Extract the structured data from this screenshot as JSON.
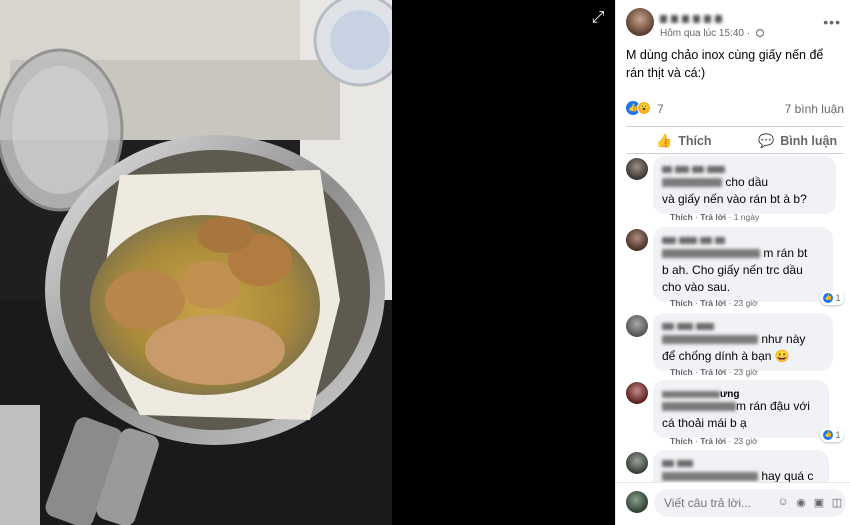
{
  "post": {
    "time": "Hôm qua lúc 15:40 · ",
    "caption": "M dùng chảo inox cùng giấy nến để rán thịt và cá:)",
    "reaction_count": "7",
    "comment_count": "7 bình luận"
  },
  "actions": {
    "like": "Thích",
    "comment": "Bình luận"
  },
  "comments": [
    {
      "text_a": " cho dầu",
      "text_b": "và giấy nến vào rán bt à b?",
      "like": "Thích",
      "reply": "Trả lời",
      "time": "1 ngày",
      "reactions": ""
    },
    {
      "text_a": "m rán bt",
      "text_b": "b ah. Cho giấy nến trc dầu",
      "text_c": "cho vào sau.",
      "like": "Thích",
      "reply": "Trả lời",
      "time": "23 giờ",
      "reactions": "1"
    },
    {
      "text_a": " như này",
      "text_b": "để chống dính à bạn 😀",
      "like": "Thích",
      "reply": "Trả lời",
      "time": "23 giờ",
      "reactions": ""
    },
    {
      "name_tail": "ưng",
      "text_a": "m rán đậu với",
      "text_b": "cá thoải mái b ạ",
      "like": "Thích",
      "reply": "Trả lời",
      "time": "23 giờ",
      "reactions": "1"
    },
    {
      "text_a": " hay quá c",
      "like": "",
      "reply": "",
      "time": "",
      "reactions": ""
    }
  ],
  "composer": {
    "placeholder": "Viết câu trả lời..."
  },
  "icons": {
    "expand": "expand-icon",
    "more": "more-icon",
    "like": "like-icon",
    "comment": "comment-icon",
    "emoji": "emoji-icon",
    "camera": "camera-icon",
    "gif": "gif-icon",
    "sticker": "sticker-icon"
  },
  "colors": {
    "accent": "#1877f2",
    "bubble": "#f0f2f5",
    "muted": "#65676b"
  }
}
